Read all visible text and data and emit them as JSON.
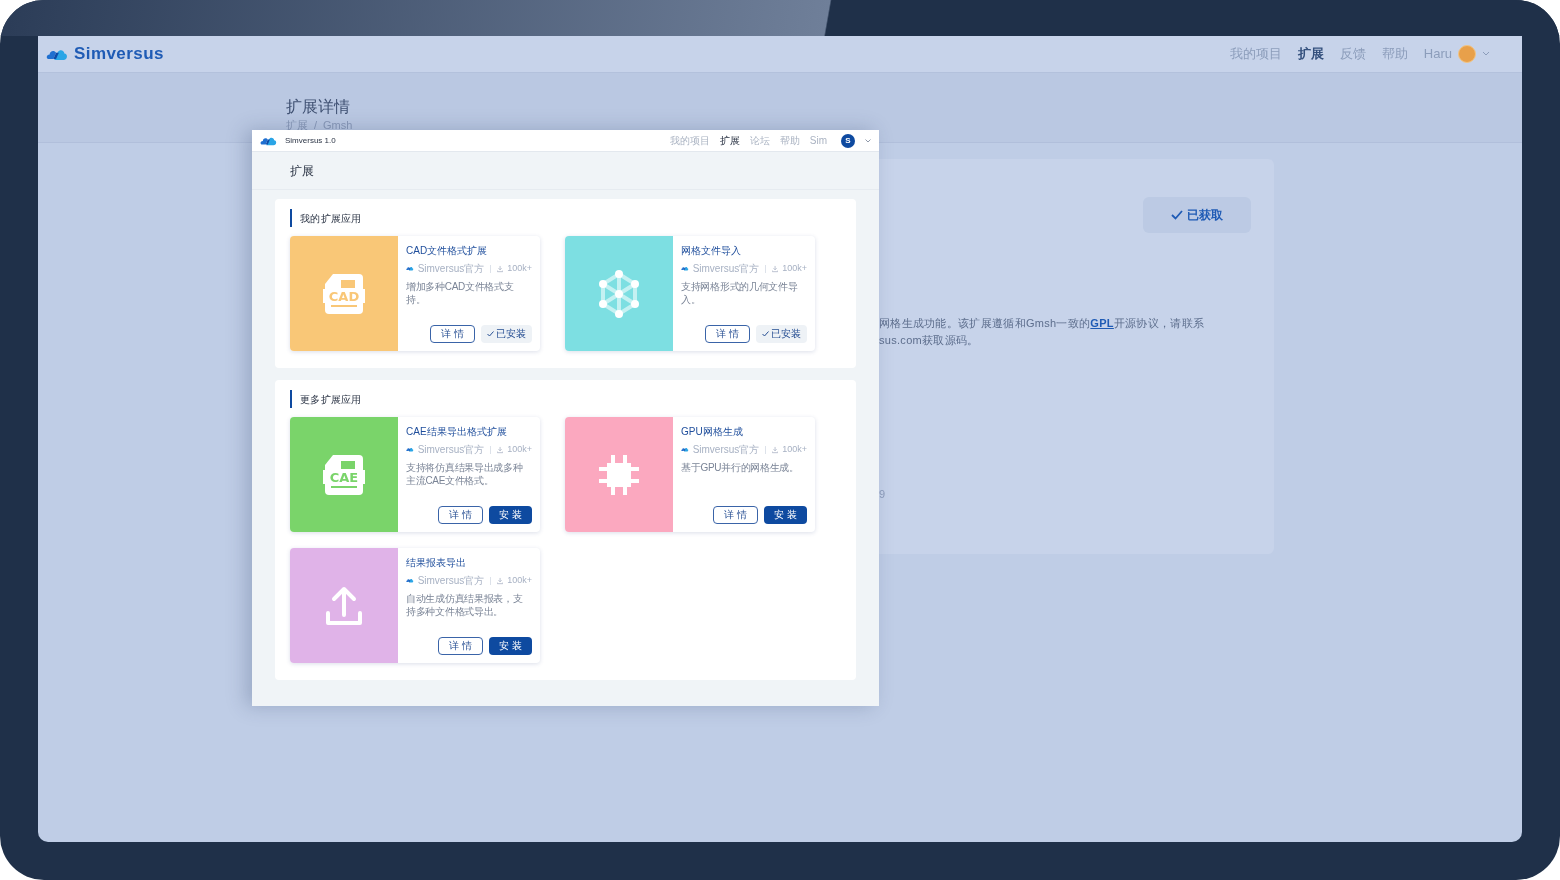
{
  "app": {
    "logo": "Simversus",
    "nav": [
      {
        "label": "我的项目",
        "selected": false
      },
      {
        "label": "扩展",
        "selected": true
      },
      {
        "label": "反馈",
        "selected": false
      },
      {
        "label": "帮助",
        "selected": false
      }
    ],
    "user": "Haru"
  },
  "page_header": {
    "title": "扩展详情",
    "breadcrumb": [
      "扩展",
      "Gmsh"
    ],
    "breadcrumb_separator": "/"
  },
  "detail_card": {
    "button": "已获取",
    "description_before": "网格生成功能。该扩展遵循和Gmsh一致的",
    "link": "GPL",
    "description_after": "开源协议，请联系",
    "description_line_2": "sus.com获取源码。",
    "footer": "9"
  },
  "dialog": {
    "app_name": "Simversus 1.0",
    "nav": [
      {
        "label": "我的项目",
        "selected": false
      },
      {
        "label": "扩展",
        "selected": true
      },
      {
        "label": "论坛",
        "selected": false
      },
      {
        "label": "帮助",
        "selected": false
      },
      {
        "label": "Sim",
        "selected": false
      }
    ],
    "avatar": "S",
    "page_title": "扩展",
    "sections": [
      {
        "title": "我的扩展应用",
        "items": [
          {
            "name": "CAD文件格式扩展",
            "kind": "document",
            "icon_label": "CAD",
            "color": "#f9c777",
            "publisher": "Simversus官方",
            "downloads": "100k+",
            "description": "增加多种CAD文件格式支持。",
            "details_button": "详 情",
            "action": {
              "label": "已安装",
              "installed": true
            }
          },
          {
            "name": "网格文件导入",
            "kind": "mesh",
            "color": "#7ddfe2",
            "publisher": "Simversus官方",
            "downloads": "100k+",
            "description": "支持网格形式的几何文件导入。",
            "details_button": "详 情",
            "action": {
              "label": "已安装",
              "installed": true
            }
          }
        ]
      },
      {
        "title": "更多扩展应用",
        "items": [
          {
            "name": "CAE结果导出格式扩展",
            "kind": "document",
            "icon_label": "CAE",
            "color": "#7ad46a",
            "publisher": "Simversus官方",
            "downloads": "100k+",
            "description": "支持将仿真结果导出成多种主流CAE文件格式。",
            "details_button": "详 情",
            "action": {
              "label": "安 装",
              "installed": false
            }
          },
          {
            "name": "GPU网格生成",
            "kind": "chip",
            "color": "#fba8bf",
            "publisher": "Simversus官方",
            "downloads": "100k+",
            "description": "基于GPU并行的网格生成。",
            "details_button": "详 情",
            "action": {
              "label": "安 装",
              "installed": false
            }
          },
          {
            "name": "结果报表导出",
            "kind": "upload",
            "color": "#e0b3e8",
            "publisher": "Simversus官方",
            "downloads": "100k+",
            "description": "自动生成仿真结果报表，支持多种文件格式导出。",
            "details_button": "详 情",
            "action": {
              "label": "安 装",
              "installed": false
            }
          }
        ]
      }
    ]
  }
}
